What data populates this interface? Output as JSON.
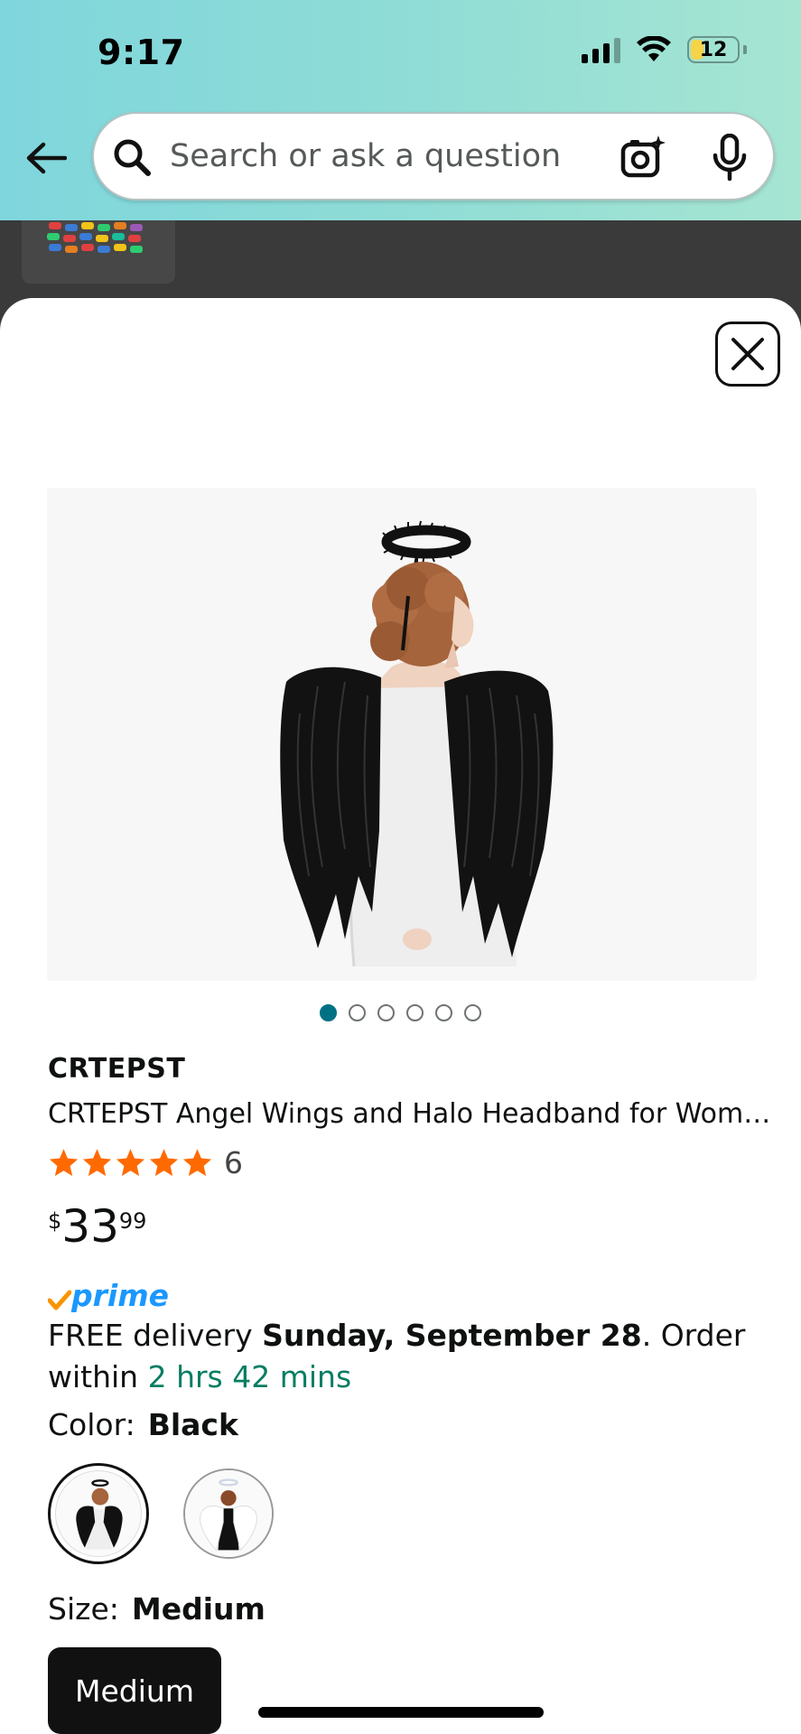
{
  "status_bar": {
    "time": "9:17",
    "battery": "12"
  },
  "search": {
    "placeholder": "Search or ask a question"
  },
  "product": {
    "brand": "CRTEPST",
    "title": "CRTEPST Angel Wings and Halo Headband for Wom…",
    "rating": 5,
    "rating_count": "6",
    "price": {
      "symbol": "$",
      "whole": "33",
      "fraction": "99"
    },
    "prime_label": "prime",
    "image_count": 6,
    "active_image": 1
  },
  "delivery": {
    "prefix": "FREE delivery ",
    "date": "Sunday, September 28",
    "order_within_prefix": ". Order within ",
    "countdown": "2 hrs 42 mins"
  },
  "color": {
    "label": "Color:",
    "selected": "Black",
    "options": [
      "Black",
      "White"
    ]
  },
  "size": {
    "label": "Size:",
    "selected": "Medium",
    "options": [
      "Medium"
    ]
  },
  "colors": {
    "accent": "#007185",
    "star": "#ff6a00",
    "prime_blue": "#1a98ff",
    "prime_check": "#f79400",
    "countdown_green": "#067d62"
  },
  "icons": [
    "back-arrow-icon",
    "search-icon",
    "camera-lens-icon",
    "microphone-icon",
    "close-icon",
    "star-icon"
  ]
}
